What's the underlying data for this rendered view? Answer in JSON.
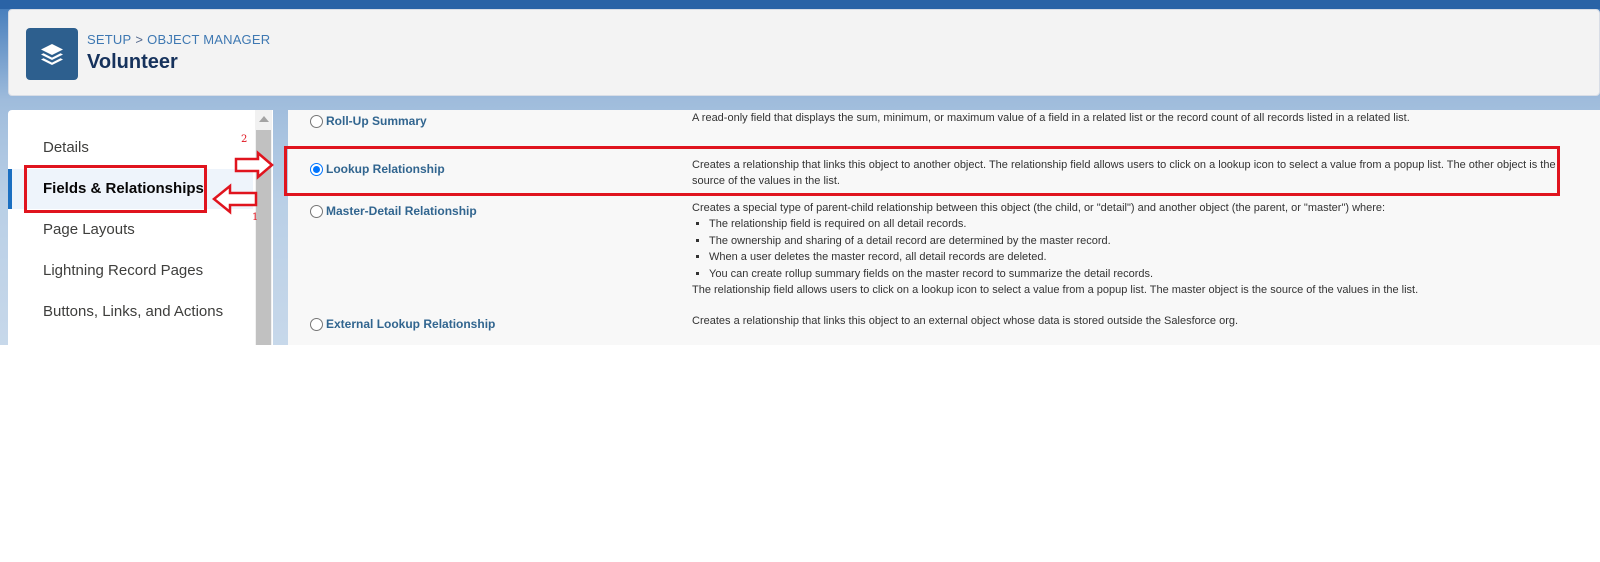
{
  "header": {
    "breadcrumb_setup": "SETUP",
    "breadcrumb_separator": ">",
    "breadcrumb_object_manager": "OBJECT MANAGER",
    "title": "Volunteer",
    "icon": "layers-icon"
  },
  "sidebar": {
    "items": [
      {
        "label": "Details",
        "active": false
      },
      {
        "label": "Fields & Relationships",
        "active": true
      },
      {
        "label": "Page Layouts",
        "active": false
      },
      {
        "label": "Lightning Record Pages",
        "active": false
      },
      {
        "label": "Buttons, Links, and Actions",
        "active": false
      }
    ]
  },
  "field_types": [
    {
      "label": "Roll-Up Summary",
      "selected": false,
      "description": "A read-only field that displays the sum, minimum, or maximum value of a field in a related list or the record count of all records listed in a related list."
    },
    {
      "label": "Lookup Relationship",
      "selected": true,
      "description": "Creates a relationship that links this object to another object. The relationship field allows users to click on a lookup icon to select a value from a popup list. The other object is the source of the values in the list."
    },
    {
      "label": "Master-Detail Relationship",
      "selected": false,
      "description": "Creates a special type of parent-child relationship between this object (the child, or \"detail\") and another object (the parent, or \"master\") where:",
      "bullets": [
        "The relationship field is required on all detail records.",
        "The ownership and sharing of a detail record are determined by the master record.",
        "When a user deletes the master record, all detail records are deleted.",
        "You can create rollup summary fields on the master record to summarize the detail records."
      ],
      "footer": "The relationship field allows users to click on a lookup icon to select a value from a popup list. The master object is the source of the values in the list."
    },
    {
      "label": "External Lookup Relationship",
      "selected": false,
      "description": "Creates a relationship that links this object to an external object whose data is stored outside the Salesforce org."
    }
  ],
  "annotations": {
    "step1": "1",
    "step2": "2",
    "color": "#e0141e"
  }
}
